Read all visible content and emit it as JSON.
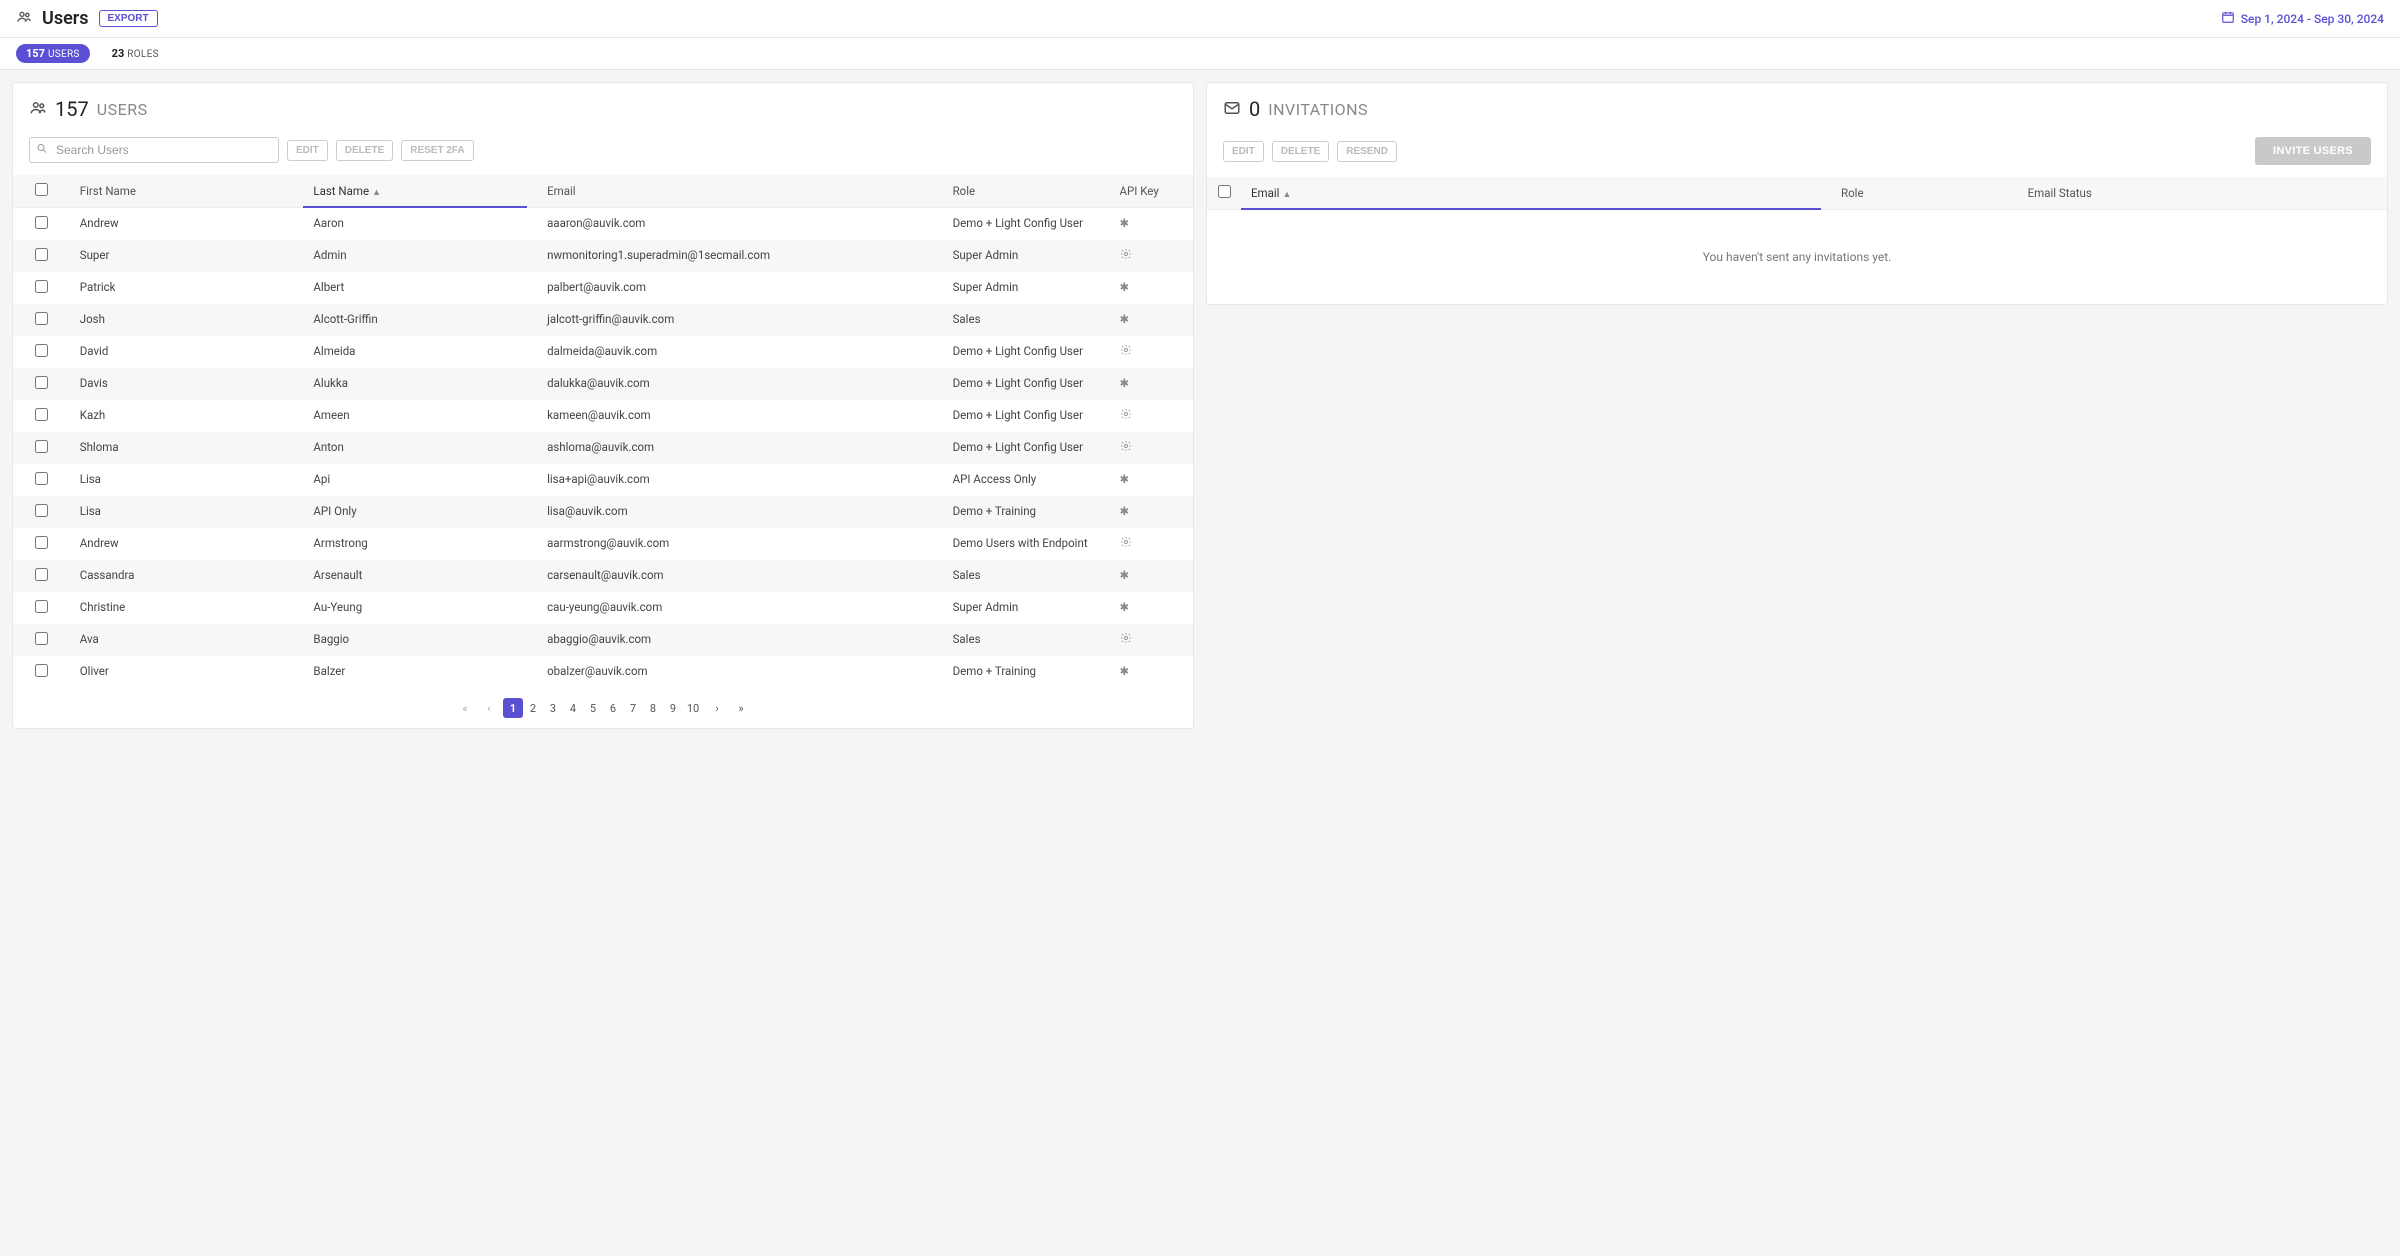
{
  "header": {
    "title": "Users",
    "export_label": "EXPORT",
    "date_range": "Sep 1, 2024 - Sep 30, 2024"
  },
  "tabs": {
    "users": {
      "count": "157",
      "label": "USERS"
    },
    "roles": {
      "count": "23",
      "label": "ROLES"
    }
  },
  "users_panel": {
    "count": "157",
    "label": "USERS",
    "search_placeholder": "Search Users",
    "btn_edit": "EDIT",
    "btn_delete": "DELETE",
    "btn_reset": "RESET 2FA",
    "columns": {
      "first_name": "First Name",
      "last_name": "Last Name",
      "email": "Email",
      "role": "Role",
      "api_key": "API Key"
    },
    "rows": [
      {
        "first": "Andrew",
        "last": "Aaron",
        "email": "aaaron@auvik.com",
        "role": "Demo + Light Config User",
        "api": "asterisk"
      },
      {
        "first": "Super",
        "last": "Admin",
        "email": "nwmonitoring1.superadmin@1secmail.com",
        "role": "Super Admin",
        "api": "gear"
      },
      {
        "first": "Patrick",
        "last": "Albert",
        "email": "palbert@auvik.com",
        "role": "Super Admin",
        "api": "asterisk"
      },
      {
        "first": "Josh",
        "last": "Alcott-Griffin",
        "email": "jalcott-griffin@auvik.com",
        "role": "Sales",
        "api": "asterisk"
      },
      {
        "first": "David",
        "last": "Almeida",
        "email": "dalmeida@auvik.com",
        "role": "Demo + Light Config User",
        "api": "gear"
      },
      {
        "first": "Davis",
        "last": "Alukka",
        "email": "dalukka@auvik.com",
        "role": "Demo + Light Config User",
        "api": "asterisk"
      },
      {
        "first": "Kazh",
        "last": "Ameen",
        "email": "kameen@auvik.com",
        "role": "Demo + Light Config User",
        "api": "gear"
      },
      {
        "first": "Shloma",
        "last": "Anton",
        "email": "ashloma@auvik.com",
        "role": "Demo + Light Config User",
        "api": "gear"
      },
      {
        "first": "Lisa",
        "last": "Api",
        "email": "lisa+api@auvik.com",
        "role": "API Access Only",
        "api": "asterisk"
      },
      {
        "first": "Lisa",
        "last": "API Only",
        "email": "lisa@auvik.com",
        "role": "Demo + Training",
        "api": "asterisk"
      },
      {
        "first": "Andrew",
        "last": "Armstrong",
        "email": "aarmstrong@auvik.com",
        "role": "Demo Users with Endpoint",
        "api": "gear"
      },
      {
        "first": "Cassandra",
        "last": "Arsenault",
        "email": "carsenault@auvik.com",
        "role": "Sales",
        "api": "asterisk"
      },
      {
        "first": "Christine",
        "last": "Au-Yeung",
        "email": "cau-yeung@auvik.com",
        "role": "Super Admin",
        "api": "asterisk"
      },
      {
        "first": "Ava",
        "last": "Baggio",
        "email": "abaggio@auvik.com",
        "role": "Sales",
        "api": "gear"
      },
      {
        "first": "Oliver",
        "last": "Balzer",
        "email": "obalzer@auvik.com",
        "role": "Demo + Training",
        "api": "asterisk"
      }
    ],
    "pages": [
      "1",
      "2",
      "3",
      "4",
      "5",
      "6",
      "7",
      "8",
      "9",
      "10"
    ],
    "current_page": "1"
  },
  "invitations_panel": {
    "count": "0",
    "label": "INVITATIONS",
    "btn_edit": "EDIT",
    "btn_delete": "DELETE",
    "btn_resend": "RESEND",
    "btn_invite": "INVITE USERS",
    "columns": {
      "email": "Email",
      "role": "Role",
      "status": "Email Status"
    },
    "empty_message": "You haven't sent any invitations yet."
  }
}
